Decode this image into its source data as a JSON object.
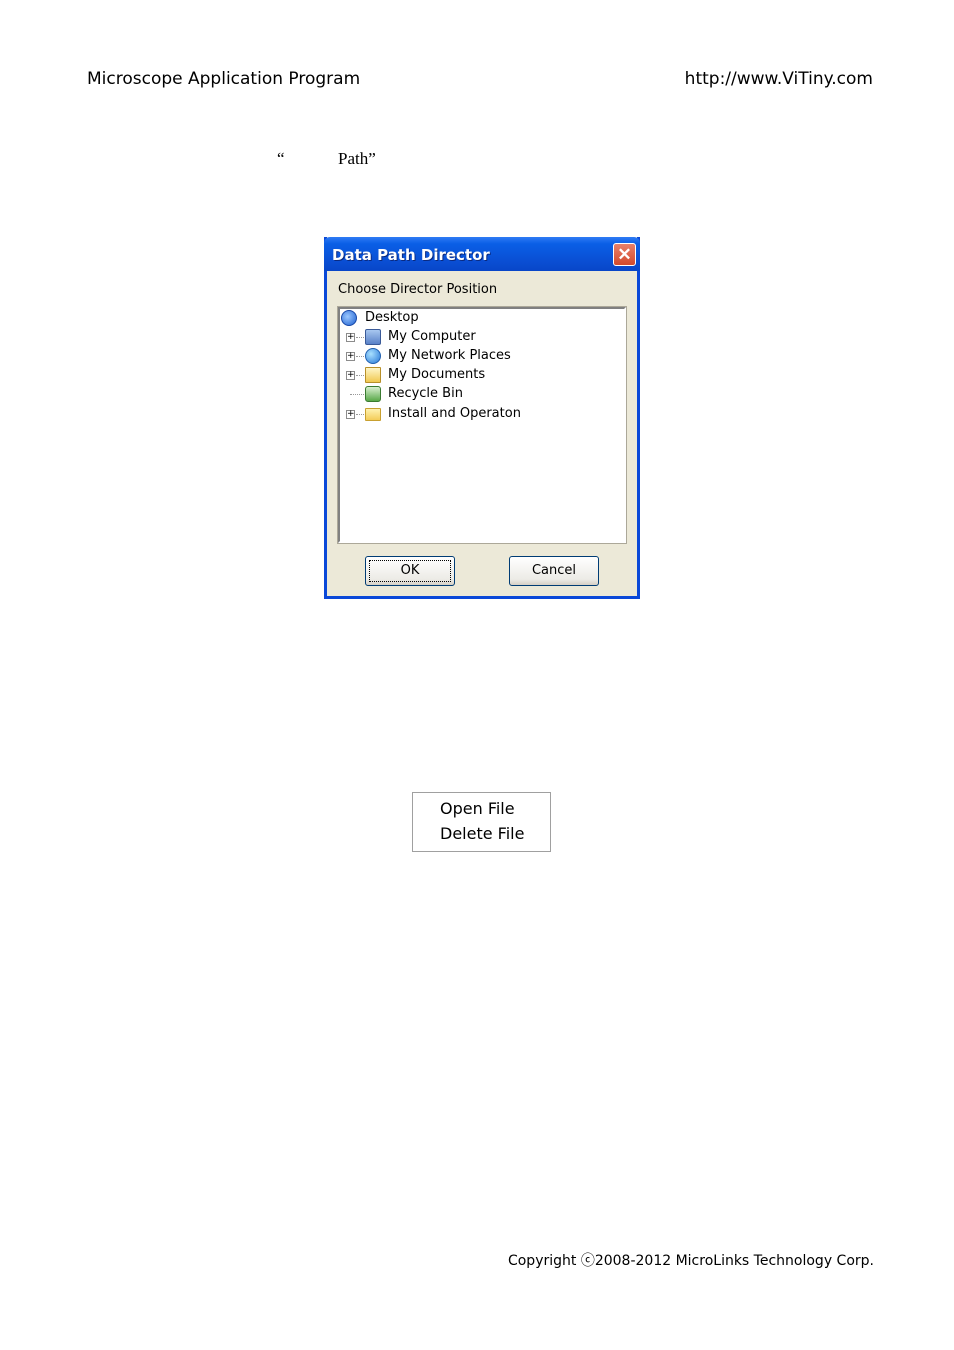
{
  "header": {
    "left": "Microscope Application Program",
    "right": "http://www.ViTiny.com"
  },
  "intro": {
    "open_quote": "“",
    "path_word": "Path”"
  },
  "dialog": {
    "title": "Data Path Director",
    "close_glyph": "✕",
    "prompt": "Choose Director Position",
    "tree": [
      {
        "label": "Desktop",
        "icon": "desktop-icon"
      },
      {
        "label": "My Computer",
        "icon": "computer-icon",
        "expander": "+"
      },
      {
        "label": "My Network Places",
        "icon": "network-places-icon",
        "expander": "+"
      },
      {
        "label": "My Documents",
        "icon": "documents-folder-icon",
        "expander": "+"
      },
      {
        "label": "Recycle Bin",
        "icon": "recycle-bin-icon"
      },
      {
        "label": "Install and Operaton",
        "icon": "folder-icon",
        "expander": "+"
      }
    ],
    "ok_label": "OK",
    "cancel_label": "Cancel"
  },
  "context_menu": {
    "items": [
      "Open File",
      "Delete File"
    ]
  },
  "footer": {
    "copyright": "Copyright ⓒ2008-2012 MicroLinks Technology Corp."
  }
}
